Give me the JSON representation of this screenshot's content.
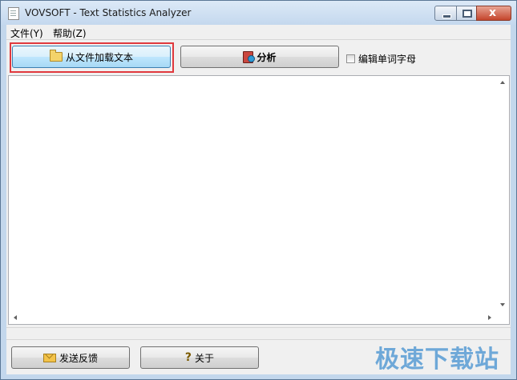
{
  "window": {
    "title": "VOVSOFT - Text Statistics Analyzer",
    "close_glyph": "x"
  },
  "menu": {
    "items": [
      {
        "label": "文件(Y)"
      },
      {
        "label": "帮助(Z)"
      }
    ]
  },
  "toolbar": {
    "load_button": {
      "label": "从文件加载文本",
      "icon": "folder-icon"
    },
    "analyze_button": {
      "label": "分析",
      "icon": "book-icon"
    },
    "edit_letters_checkbox": {
      "label": "编辑单词字母",
      "checked": false
    }
  },
  "bottom": {
    "feedback_button": {
      "label": "发送反馈",
      "icon": "mail-icon"
    },
    "about_button": {
      "label": "关于",
      "icon": "help-icon",
      "icon_glyph": "?"
    }
  },
  "watermark": {
    "text": "极速下载站"
  },
  "colors": {
    "highlight": "#e0393e",
    "watermark": "#6ea8d8",
    "frame": "#c3d7ec"
  }
}
